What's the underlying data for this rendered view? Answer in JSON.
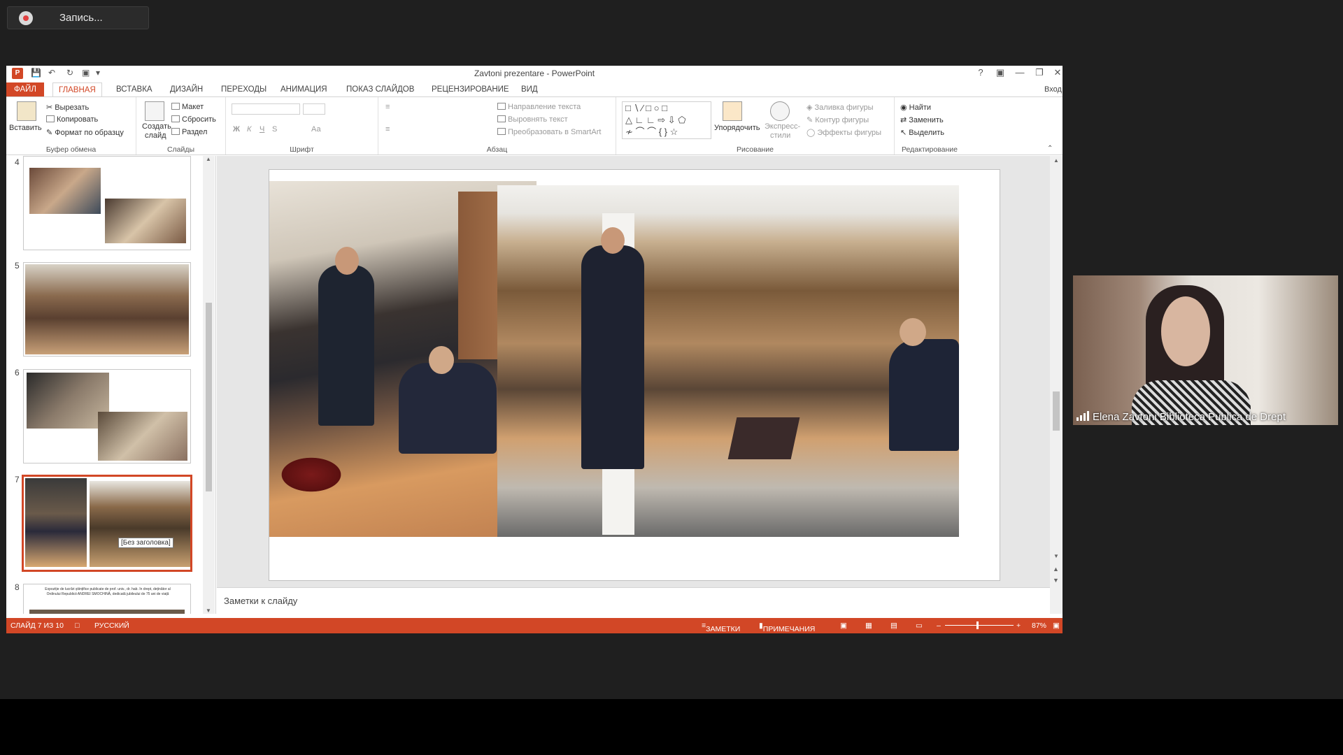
{
  "recording": {
    "label": "Запись..."
  },
  "powerpoint": {
    "title": "Zavtoni prezentare - PowerPoint",
    "signin": "Вход",
    "help": "?",
    "tabs": [
      "ФАЙЛ",
      "ГЛАВНАЯ",
      "ВСТАВКА",
      "ДИЗАЙН",
      "ПЕРЕХОДЫ",
      "АНИМАЦИЯ",
      "ПОКАЗ СЛАЙДОВ",
      "РЕЦЕНЗИРОВАНИЕ",
      "ВИД"
    ],
    "ribbon": {
      "clipboard": {
        "paste": "Вставить",
        "cut": "Вырезать",
        "copy": "Копировать",
        "format_painter": "Формат по образцу",
        "label": "Буфер обмена"
      },
      "slides": {
        "new_slide_1": "Создать",
        "new_slide_2": "слайд",
        "layout": "Макет",
        "reset": "Сбросить",
        "section": "Раздел",
        "label": "Слайды"
      },
      "font": {
        "bold": "Ж",
        "italic": "К",
        "underline": "Ч",
        "strike": "S",
        "case": "Аа",
        "label": "Шрифт"
      },
      "paragraph": {
        "text_direction": "Направление текста",
        "align_text": "Выровнять текст",
        "smartart": "Преобразовать в SmartArt",
        "label": "Абзац"
      },
      "drawing": {
        "arrange": "Упорядочить",
        "quick_styles_1": "Экспресс-",
        "quick_styles_2": "стили",
        "fill": "Заливка фигуры",
        "outline": "Контур фигуры",
        "effects": "Эффекты фигуры",
        "label": "Рисование"
      },
      "editing": {
        "find": "Найти",
        "replace": "Заменить",
        "select": "Выделить",
        "label": "Редактирование"
      }
    },
    "thumbnails": [
      {
        "num": "4"
      },
      {
        "num": "5"
      },
      {
        "num": "6"
      },
      {
        "num": "7"
      },
      {
        "num": "8"
      }
    ],
    "thumb8_text": "Expoziție de lucrări științifice publicate de prof. univ., dr. hab. în drept, deținător al Ordinului Republicii ANDREI SMOCHINĂ, dedicată jubileului de 75 ani de viață",
    "tooltip": "[Без заголовка]",
    "notes_placeholder": "Заметки к слайду",
    "status": {
      "slide": "СЛАЙД 7 ИЗ 10",
      "language": "РУССКИЙ",
      "notes": "ЗАМЕТКИ",
      "comments": "ПРИМЕЧАНИЯ",
      "zoom": "87%"
    }
  },
  "participant": {
    "name": "Elena Zavtoni Biblioteca Publica de Drept"
  },
  "colors": {
    "accent": "#d24726",
    "zoom_bg": "#1f1f1f"
  }
}
